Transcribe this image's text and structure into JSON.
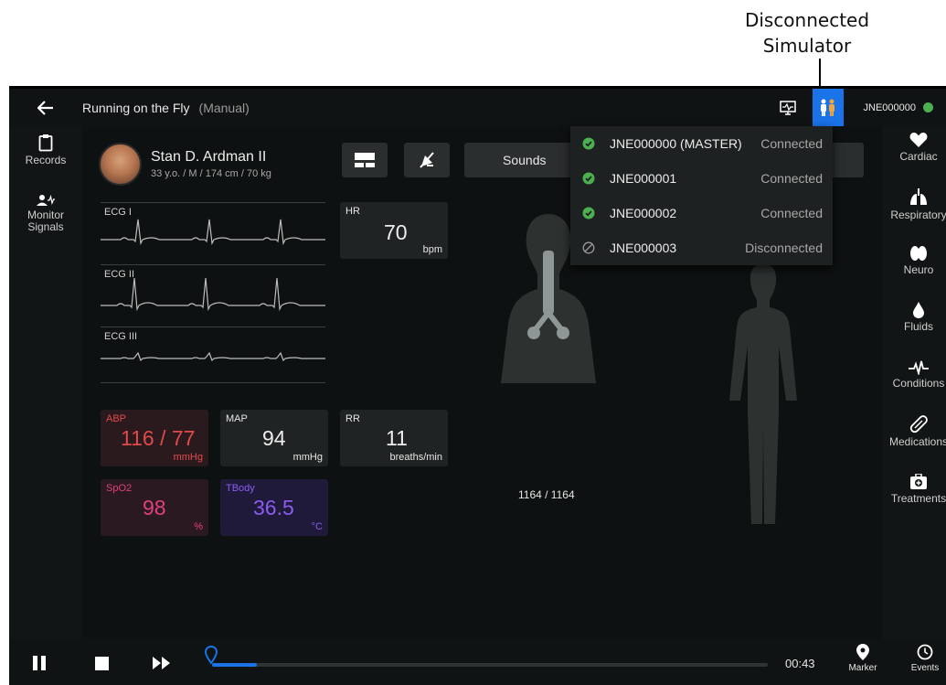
{
  "callout": {
    "line1": "Disconnected",
    "line2": "Simulator"
  },
  "topbar": {
    "back_icon": "arrow-left-icon",
    "title": "Running on the Fly",
    "mode": "(Manual)",
    "monitor_icon": "monitor-icon",
    "simulator_icon": "people-icon",
    "simulator_id": "JNE000000",
    "status_color": "#4caf50",
    "accent_color": "#1a73e8"
  },
  "left_sidebar": {
    "items": [
      {
        "label": "Records",
        "icon": "clipboard-icon"
      },
      {
        "label": "Monitor Signals",
        "icon": "person-pulse-icon"
      }
    ]
  },
  "right_sidebar": {
    "items": [
      {
        "label": "Cardiac",
        "icon": "heart-icon"
      },
      {
        "label": "Respiratory",
        "icon": "lungs-icon"
      },
      {
        "label": "Neuro",
        "icon": "brain-icon"
      },
      {
        "label": "Fluids",
        "icon": "drop-icon"
      },
      {
        "label": "Conditions",
        "icon": "pulse-icon"
      },
      {
        "label": "Medications",
        "icon": "pill-icon"
      },
      {
        "label": "Treatments",
        "icon": "medkit-icon"
      }
    ]
  },
  "patient": {
    "name": "Stan D. Ardman II",
    "details": "33 y.o. / M / 174 cm / 70 kg"
  },
  "toolbar": {
    "sounds_label": "Sounds"
  },
  "ecg": [
    {
      "label": "ECG I"
    },
    {
      "label": "ECG II"
    },
    {
      "label": "ECG III"
    }
  ],
  "vitals": {
    "hr": {
      "label": "HR",
      "value": "70",
      "unit": "bpm"
    },
    "abp": {
      "label": "ABP",
      "value": "116 / 77",
      "unit": "mmHg"
    },
    "map": {
      "label": "MAP",
      "value": "94",
      "unit": "mmHg"
    },
    "rr": {
      "label": "RR",
      "value": "11",
      "unit": "breaths/min"
    },
    "spo2": {
      "label": "SpO2",
      "value": "98",
      "unit": "%"
    },
    "tbody": {
      "label": "TBody",
      "value": "36.5",
      "unit": "°C"
    }
  },
  "lungs_counter": "1164 / 1164",
  "simulators": [
    {
      "name": "JNE000000 (MASTER)",
      "status": "Connected",
      "connected": true
    },
    {
      "name": "JNE000001",
      "status": "Connected",
      "connected": true
    },
    {
      "name": "JNE000002",
      "status": "Connected",
      "connected": true
    },
    {
      "name": "JNE000003",
      "status": "Disconnected",
      "connected": false
    }
  ],
  "playback": {
    "time": "00:43",
    "progress": 0.02,
    "marker_label": "Marker",
    "events_label": "Events"
  }
}
